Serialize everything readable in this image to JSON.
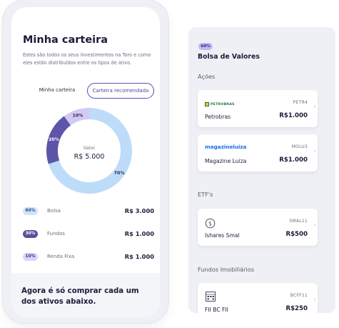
{
  "portfolio": {
    "title": "Minha carteira",
    "description": "Estes são todos os seus investimentos na Toro e como eles estão distribuídos entre os tipos de ativo.",
    "tabs": [
      {
        "label": "Minha carteira",
        "active": false
      },
      {
        "label": "Carteira recomendada",
        "active": true
      }
    ],
    "donut": {
      "center_label": "Valor",
      "center_value": "R$ 5.000",
      "segments": [
        {
          "label": "70%",
          "percent": 70,
          "color": "#bcdcf9"
        },
        {
          "label": "20%",
          "percent": 20,
          "color": "#5c55a9"
        },
        {
          "label": "10%",
          "percent": 10,
          "color": "#d4c9f6"
        }
      ]
    },
    "allocations": [
      {
        "badge": "60%",
        "name": "Bolsa",
        "value": "R$ 3.000",
        "badge_bg": "#cfe3fa",
        "badge_fg": "#2a4f84"
      },
      {
        "badge": "30%",
        "name": "Fundos",
        "value": "R$ 1.000",
        "badge_bg": "#58509c",
        "badge_fg": "#ffffff"
      },
      {
        "badge": "10%",
        "name": "Renda Fixa",
        "value": "R$ 1.000",
        "badge_bg": "#dcd2f7",
        "badge_fg": "#3b2f8a"
      }
    ],
    "footer_text": "Agora é só comprar cada um dos ativos abaixo."
  },
  "recommendations": {
    "badge": "60%",
    "title": "Bolsa de Valores",
    "sections": [
      {
        "label": "Ações",
        "cards": [
          {
            "logo": "PETROBRAS",
            "icon": "petrobras-logo-icon",
            "ticker": "PETR4",
            "name": "Petrobras",
            "price": "R$1.000"
          },
          {
            "logo": "magazineluiza",
            "icon": "magazine-luiza-logo-icon",
            "ticker": "MGLU3",
            "name": "Magazine Luiza",
            "price": "R$1.000"
          }
        ]
      },
      {
        "label": "ETF's",
        "cards": [
          {
            "icon": "dollar-circle-icon",
            "ticker": "SMAL11",
            "name": "Ishares Smal",
            "price": "R$500"
          }
        ]
      },
      {
        "label": "Fundos Imobiliários",
        "cards": [
          {
            "icon": "building-icon",
            "ticker": "BCFF11",
            "name": "FII BC FII",
            "price": "R$250"
          }
        ]
      }
    ],
    "chevron": "›"
  }
}
